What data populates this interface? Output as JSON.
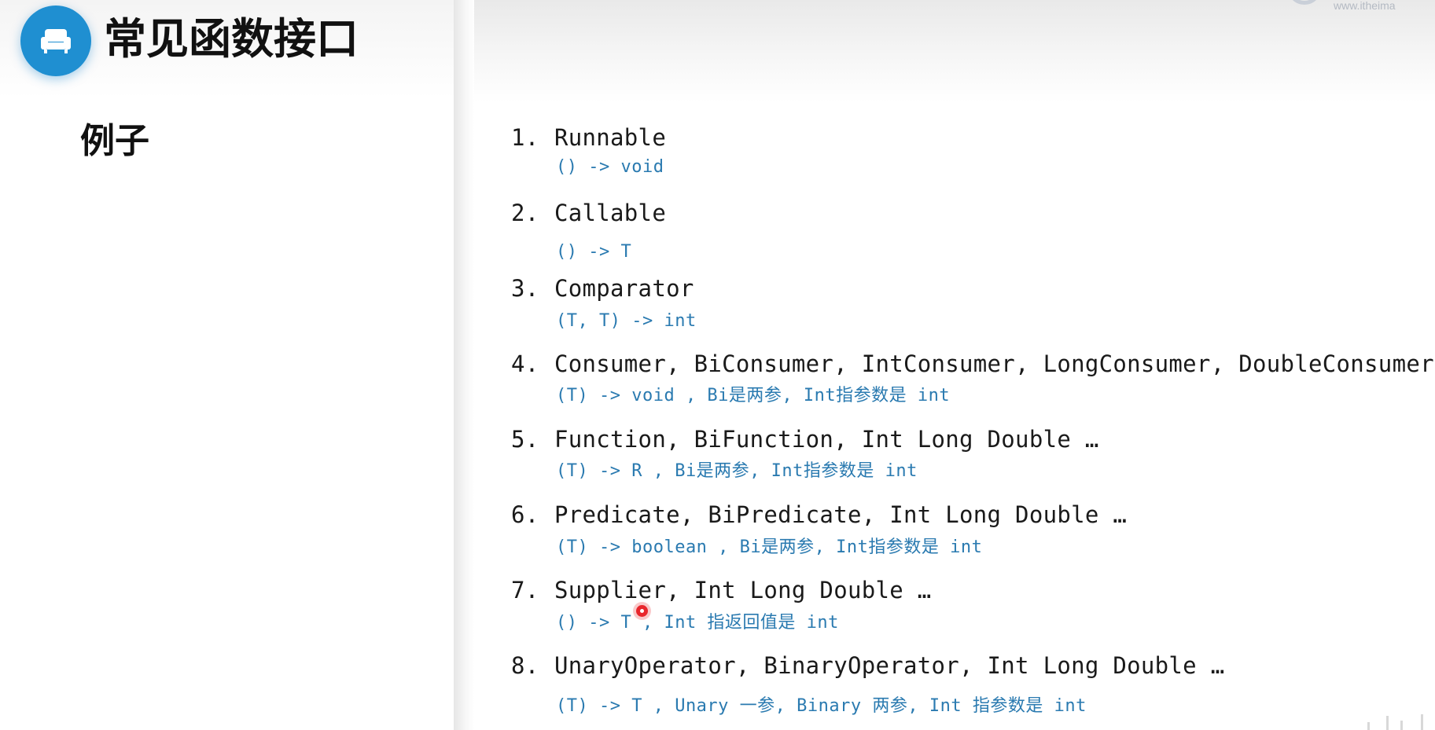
{
  "slide": {
    "title": "常见函数接口",
    "section": "例子"
  },
  "watermark": {
    "text": "www.itheima"
  },
  "items": [
    {
      "number": "1.",
      "title": "Runnable",
      "signature": "() -> void"
    },
    {
      "number": "2.",
      "title": "Callable",
      "signature": "() -> T"
    },
    {
      "number": "3.",
      "title": "Comparator",
      "signature": "(T, T) -> int"
    },
    {
      "number": "4.",
      "title": "Consumer, BiConsumer, IntConsumer, LongConsumer, DoubleConsumer",
      "signature": "(T) -> void , Bi是两参, Int指参数是 int"
    },
    {
      "number": "5.",
      "title": "Function, BiFunction,  Int Long Double …",
      "signature": "(T) -> R , Bi是两参, Int指参数是 int"
    },
    {
      "number": "6.",
      "title": "Predicate, BiPredicate, Int Long Double …",
      "signature": "(T) -> boolean , Bi是两参, Int指参数是 int"
    },
    {
      "number": "7.",
      "title": "Supplier, Int Long Double …",
      "signature": "() -> T , Int 指返回值是 int"
    },
    {
      "number": "8.",
      "title": "UnaryOperator, BinaryOperator, Int Long Double …",
      "signature": "(T) -> T , Unary 一参, Binary 两参, Int 指参数是 int"
    }
  ],
  "colors": {
    "accent": "#1f8fd1",
    "signature_text": "#2a7ab0",
    "title_text": "#1a1a1a",
    "cursor": "#e8262c"
  },
  "icons": {
    "logo": "sofa-icon",
    "cursor": "laser-pointer-dot"
  }
}
